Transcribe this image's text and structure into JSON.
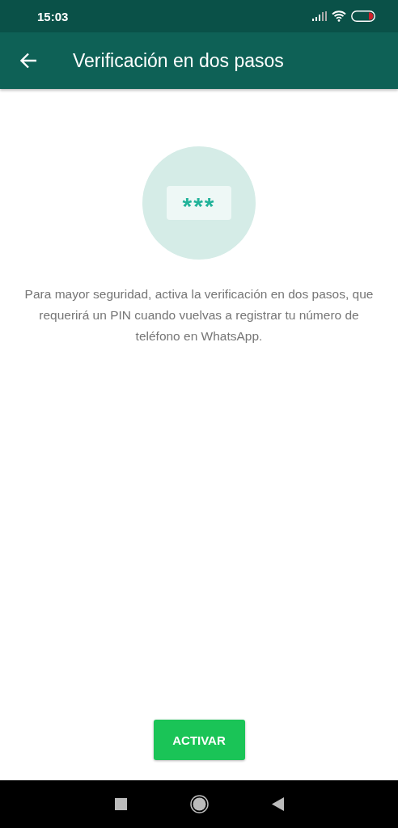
{
  "status_bar": {
    "time": "15:03"
  },
  "app_bar": {
    "title": "Verificación en dos pasos"
  },
  "illustration": {
    "pin_mask": "***"
  },
  "description": "Para mayor seguridad, activa la verificación en dos pasos, que requerirá un PIN cuando vuelvas a registrar tu número de teléfono en WhatsApp.",
  "button": {
    "label": "ACTIVAR"
  }
}
